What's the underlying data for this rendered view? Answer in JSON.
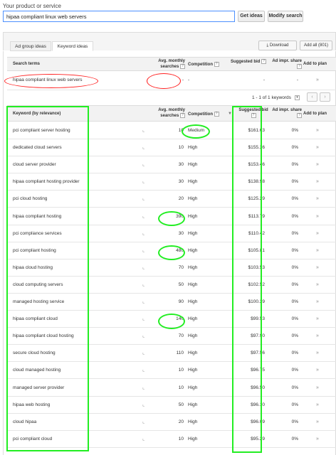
{
  "search": {
    "label": "Your product or service",
    "value": "hipaa compliant linux web servers",
    "get_ideas": "Get ideas",
    "modify_search": "Modify search"
  },
  "tabs": {
    "ad_group": "Ad group ideas",
    "keyword": "Keyword ideas"
  },
  "toolbar": {
    "download": "Download",
    "add_all": "Add all (801)",
    "download_icon": "download-icon"
  },
  "search_terms_header": {
    "term": "Search terms",
    "avg": "Avg. monthly searches",
    "competition": "Competition",
    "bid": "Suggested bid",
    "share": "Ad impr. share",
    "add": "Add to plan"
  },
  "search_term_row": {
    "keyword": "hipaa compliant linux web servers",
    "avg": "-",
    "competition": "-",
    "bid": "-",
    "share": "-",
    "add": "»"
  },
  "pager": {
    "text": "1 - 1 of 1 keywords",
    "prev": "‹",
    "next": "›"
  },
  "keyword_header": {
    "keyword": "Keyword (by relevance)",
    "avg": "Avg. monthly searches",
    "competition": "Competition",
    "bid": "Suggested bid",
    "share": "Ad impr. share",
    "add": "Add to plan"
  },
  "keywords": [
    {
      "keyword": "pci compliant server hosting",
      "avg": "10",
      "competition": "Medium",
      "bid": "$161.63",
      "share": "0%"
    },
    {
      "keyword": "dedicated cloud servers",
      "avg": "10",
      "competition": "High",
      "bid": "$155.36",
      "share": "0%"
    },
    {
      "keyword": "cloud server provider",
      "avg": "30",
      "competition": "High",
      "bid": "$153.46",
      "share": "0%"
    },
    {
      "keyword": "hipaa compliant hosting provider",
      "avg": "30",
      "competition": "High",
      "bid": "$138.98",
      "share": "0%"
    },
    {
      "keyword": "pci cloud hosting",
      "avg": "20",
      "competition": "High",
      "bid": "$125.29",
      "share": "0%"
    },
    {
      "keyword": "hipaa compliant hosting",
      "avg": "390",
      "competition": "High",
      "bid": "$113.79",
      "share": "0%"
    },
    {
      "keyword": "pci compliance services",
      "avg": "30",
      "competition": "High",
      "bid": "$110.42",
      "share": "0%"
    },
    {
      "keyword": "pci compliant hosting",
      "avg": "480",
      "competition": "High",
      "bid": "$105.81",
      "share": "0%"
    },
    {
      "keyword": "hipaa cloud hosting",
      "avg": "70",
      "competition": "High",
      "bid": "$103.53",
      "share": "0%"
    },
    {
      "keyword": "cloud computing servers",
      "avg": "50",
      "competition": "High",
      "bid": "$102.52",
      "share": "0%"
    },
    {
      "keyword": "managed hosting service",
      "avg": "90",
      "competition": "High",
      "bid": "$100.39",
      "share": "0%"
    },
    {
      "keyword": "hipaa compliant cloud",
      "avg": "140",
      "competition": "High",
      "bid": "$99.53",
      "share": "0%"
    },
    {
      "keyword": "hipaa compliant cloud hosting",
      "avg": "70",
      "competition": "High",
      "bid": "$97.90",
      "share": "0%"
    },
    {
      "keyword": "secure cloud hosting",
      "avg": "110",
      "competition": "High",
      "bid": "$97.56",
      "share": "0%"
    },
    {
      "keyword": "cloud managed hosting",
      "avg": "10",
      "competition": "High",
      "bid": "$96.75",
      "share": "0%"
    },
    {
      "keyword": "managed server provider",
      "avg": "10",
      "competition": "High",
      "bid": "$96.50",
      "share": "0%"
    },
    {
      "keyword": "hipaa web hosting",
      "avg": "50",
      "competition": "High",
      "bid": "$96.10",
      "share": "0%"
    },
    {
      "keyword": "cloud hipaa",
      "avg": "20",
      "competition": "High",
      "bid": "$96.09",
      "share": "0%"
    },
    {
      "keyword": "pci compliant cloud",
      "avg": "10",
      "competition": "High",
      "bid": "$95.29",
      "share": "0%"
    }
  ],
  "row_icons": {
    "trend": "trend-chart-icon",
    "add": "»"
  },
  "annotation_colors": {
    "red": "#ff1f1f",
    "green": "#22ee22"
  }
}
